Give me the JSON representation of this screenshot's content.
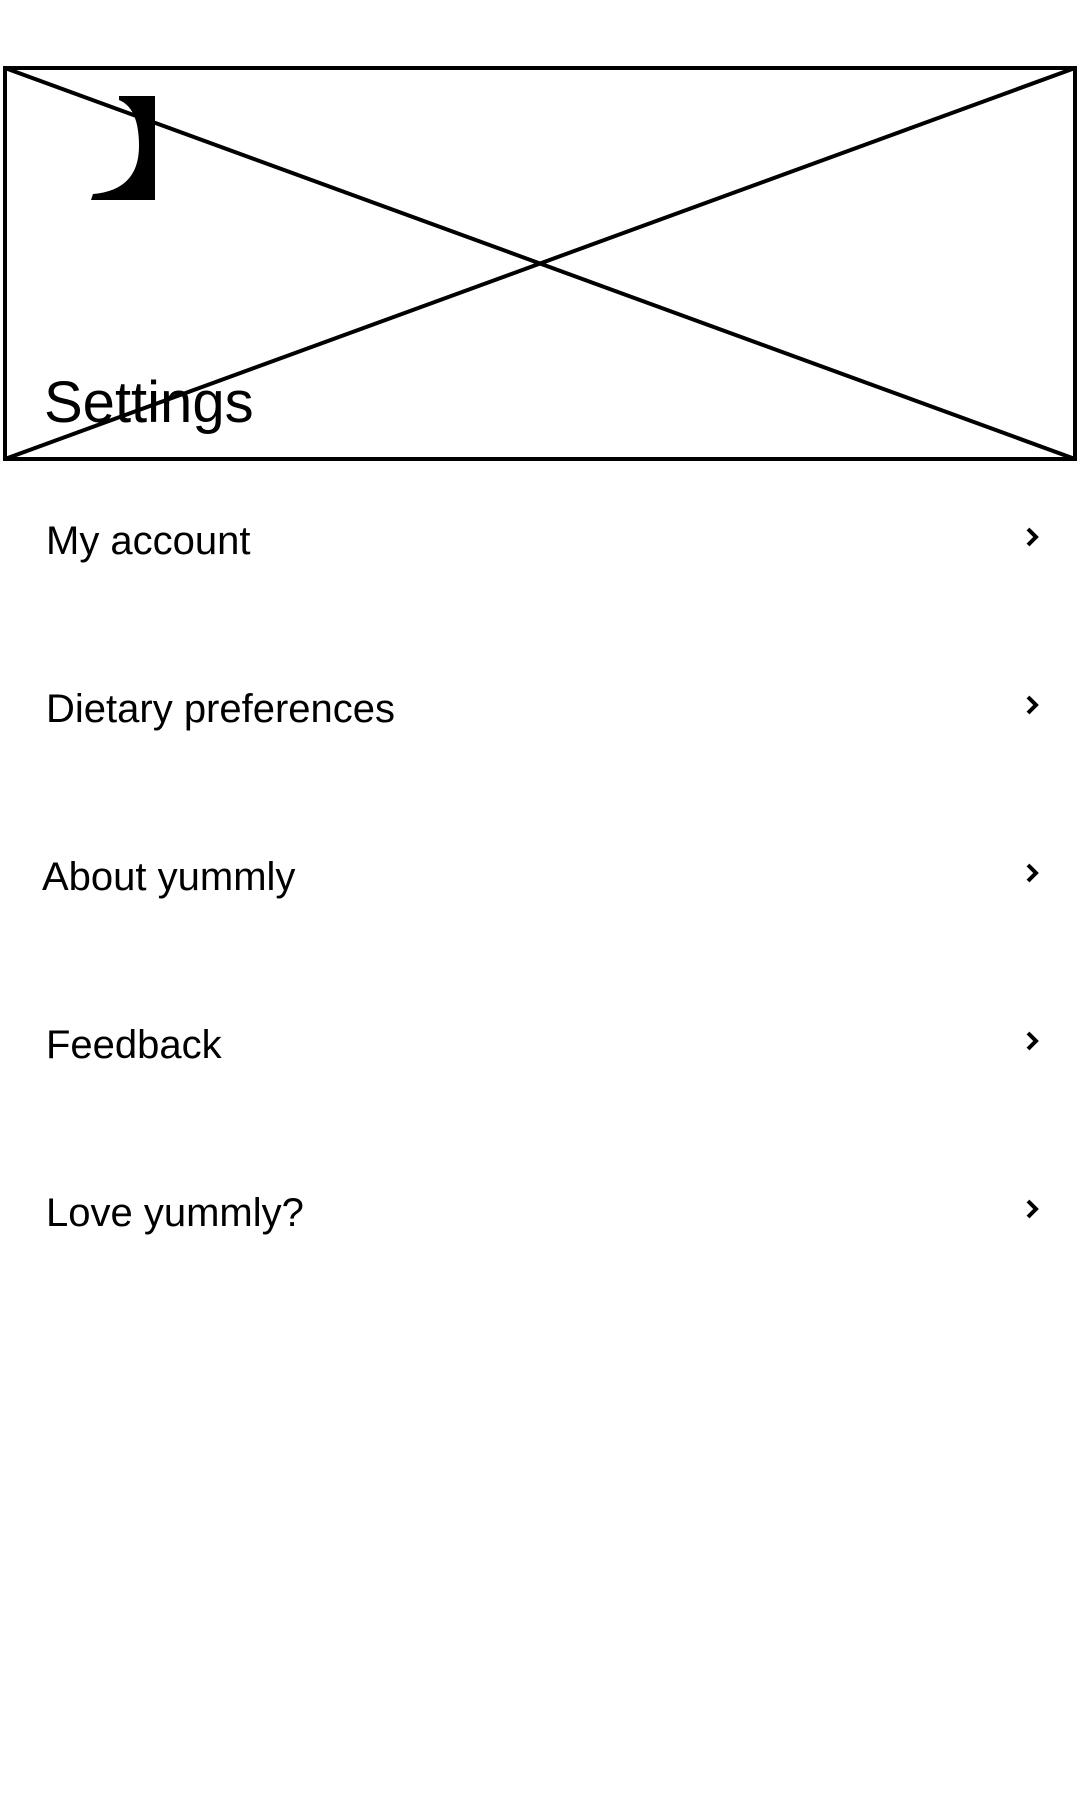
{
  "header": {
    "title": "Settings",
    "back_icon": "back-arrow-icon",
    "image_placeholder": "image-placeholder"
  },
  "menu": {
    "items": [
      {
        "label": "My account",
        "icon": "chevron-right-icon"
      },
      {
        "label": "Dietary preferences",
        "icon": "chevron-right-icon"
      },
      {
        "label": "About yummly",
        "icon": "chevron-right-icon"
      },
      {
        "label": "Feedback",
        "icon": "chevron-right-icon"
      },
      {
        "label": "Love yummly?",
        "icon": "chevron-right-icon"
      }
    ]
  },
  "colors": {
    "background": "#ffffff",
    "foreground": "#000000"
  }
}
